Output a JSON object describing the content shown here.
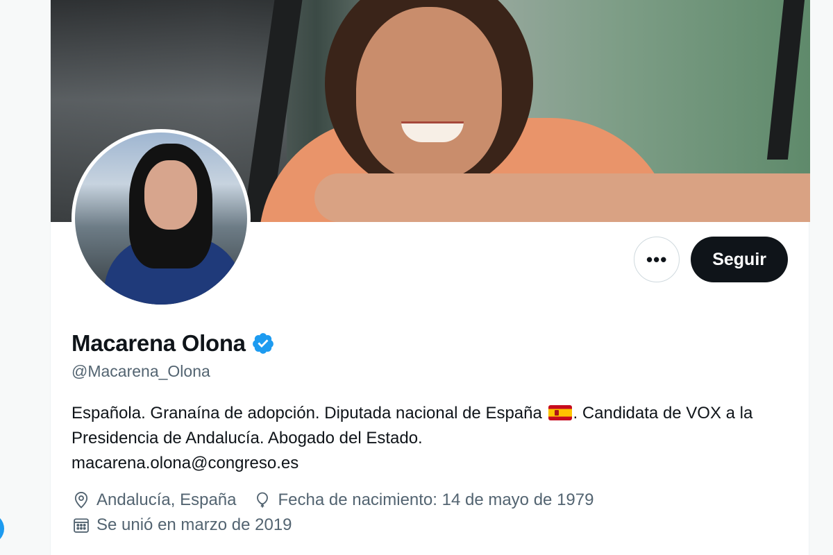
{
  "profile": {
    "display_name": "Macarena Olona",
    "handle": "@Macarena_Olona",
    "verified": true,
    "bio_part1": "Española. Granaína de adopción. Diputada nacional de España ",
    "bio_part2": ". Candidata de VOX a la Presidencia de Andalucía. Abogado del Estado.",
    "bio_email": "macarena.olona@congreso.es",
    "location": "Andalucía, España",
    "birthday": "Fecha de nacimiento: 14 de mayo de 1979",
    "joined": "Se unió en marzo de 2019"
  },
  "actions": {
    "more_label": "•••",
    "follow_label": "Seguir"
  },
  "icons": {
    "verified": "verified-badge-icon",
    "flag": "spain-flag-icon",
    "location": "location-pin-icon",
    "birthday": "balloon-icon",
    "joined": "calendar-icon"
  },
  "colors": {
    "accent": "#1d9bf0",
    "text_primary": "#0f1419",
    "text_secondary": "#536471",
    "follow_button_bg": "#0f1419"
  }
}
